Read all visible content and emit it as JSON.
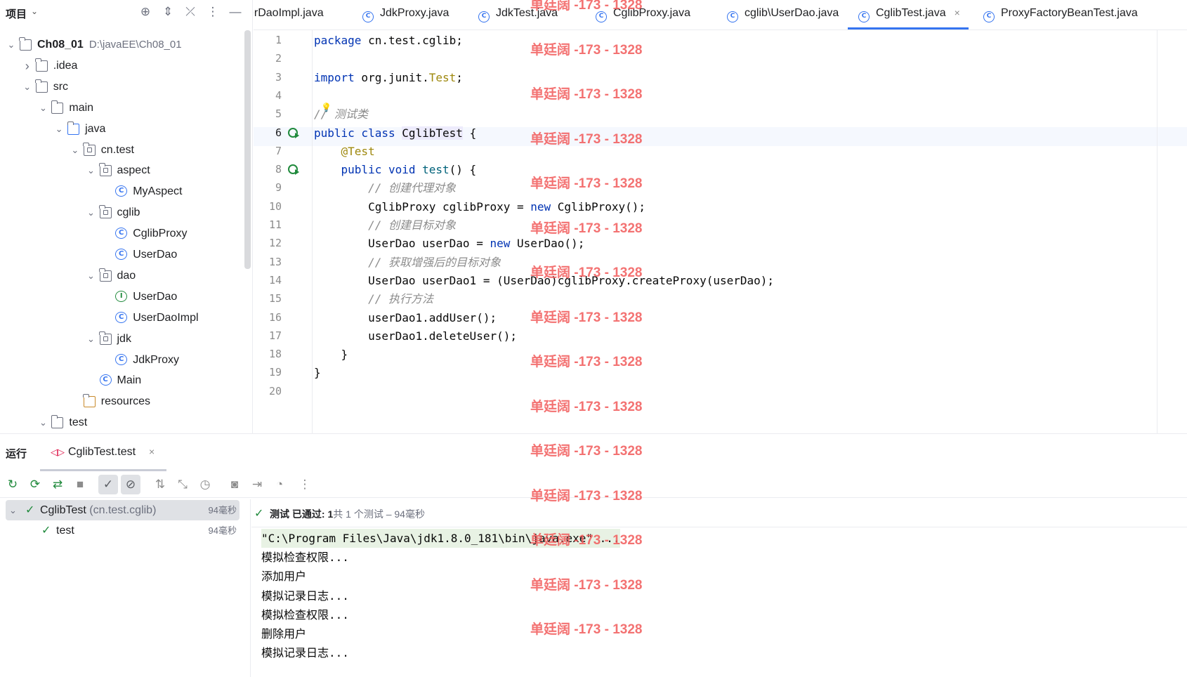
{
  "project": {
    "title": "项目",
    "tree": [
      {
        "label": "Ch08_01",
        "path": "D:\\javaEE\\Ch08_01",
        "type": "module",
        "depth": 0,
        "expanded": true
      },
      {
        "label": ".idea",
        "type": "folder",
        "depth": 1,
        "expanded": false
      },
      {
        "label": "src",
        "type": "folder",
        "depth": 1,
        "expanded": true
      },
      {
        "label": "main",
        "type": "folder",
        "depth": 2,
        "expanded": true
      },
      {
        "label": "java",
        "type": "src-folder",
        "depth": 3,
        "expanded": true
      },
      {
        "label": "cn.test",
        "type": "package",
        "depth": 4,
        "expanded": true
      },
      {
        "label": "aspect",
        "type": "package",
        "depth": 5,
        "expanded": true
      },
      {
        "label": "MyAspect",
        "type": "class",
        "depth": 6
      },
      {
        "label": "cglib",
        "type": "package",
        "depth": 5,
        "expanded": true
      },
      {
        "label": "CglibProxy",
        "type": "class",
        "depth": 6
      },
      {
        "label": "UserDao",
        "type": "class",
        "depth": 6
      },
      {
        "label": "dao",
        "type": "package",
        "depth": 5,
        "expanded": true
      },
      {
        "label": "UserDao",
        "type": "interface",
        "depth": 6
      },
      {
        "label": "UserDaoImpl",
        "type": "class",
        "depth": 6
      },
      {
        "label": "jdk",
        "type": "package",
        "depth": 5,
        "expanded": true
      },
      {
        "label": "JdkProxy",
        "type": "class",
        "depth": 6
      },
      {
        "label": "Main",
        "type": "main-class",
        "depth": 5
      },
      {
        "label": "resources",
        "type": "res-folder",
        "depth": 4
      },
      {
        "label": "test",
        "type": "folder",
        "depth": 2,
        "expanded": true
      }
    ]
  },
  "tabs": [
    {
      "label": "erDaoImpl.java"
    },
    {
      "label": "JdkProxy.java"
    },
    {
      "label": "JdkTest.java"
    },
    {
      "label": "CglibProxy.java"
    },
    {
      "label": "cglib\\UserDao.java"
    },
    {
      "label": "CglibTest.java",
      "active": true,
      "close": "×"
    },
    {
      "label": "ProxyFactoryBeanTest.java"
    }
  ],
  "editor": {
    "current_line": 6,
    "lines": [
      {
        "n": "1",
        "tokens": [
          [
            "kw",
            "package"
          ],
          [
            "",
            " cn.test.cglib;"
          ]
        ]
      },
      {
        "n": "2",
        "tokens": []
      },
      {
        "n": "3",
        "tokens": [
          [
            "kw",
            "import"
          ],
          [
            "",
            " org.junit."
          ],
          [
            "ann",
            "Test"
          ],
          [
            "",
            ";"
          ]
        ]
      },
      {
        "n": "4",
        "tokens": []
      },
      {
        "n": "5",
        "tokens": [
          [
            "cmt",
            "// 测试类"
          ]
        ]
      },
      {
        "n": "6",
        "tokens": [
          [
            "kw",
            "public class "
          ],
          [
            "hl",
            "CglibTest"
          ],
          [
            "",
            " {"
          ]
        ],
        "run": true
      },
      {
        "n": "7",
        "tokens": [
          [
            "",
            "    "
          ],
          [
            "ann",
            "@Test"
          ]
        ]
      },
      {
        "n": "8",
        "tokens": [
          [
            "",
            "    "
          ],
          [
            "kw",
            "public void "
          ],
          [
            "fn",
            "test"
          ],
          [
            "",
            "() {"
          ]
        ],
        "run": true
      },
      {
        "n": "9",
        "tokens": [
          [
            "",
            "        "
          ],
          [
            "cmt",
            "// 创建代理对象"
          ]
        ]
      },
      {
        "n": "10",
        "tokens": [
          [
            "",
            "        CglibProxy cglibProxy = "
          ],
          [
            "kw",
            "new"
          ],
          [
            "",
            " CglibProxy();"
          ]
        ]
      },
      {
        "n": "11",
        "tokens": [
          [
            "",
            "        "
          ],
          [
            "cmt",
            "// 创建目标对象"
          ]
        ]
      },
      {
        "n": "12",
        "tokens": [
          [
            "",
            "        UserDao userDao = "
          ],
          [
            "kw",
            "new"
          ],
          [
            "",
            " UserDao();"
          ]
        ]
      },
      {
        "n": "13",
        "tokens": [
          [
            "",
            "        "
          ],
          [
            "cmt",
            "// 获取增强后的目标对象"
          ]
        ]
      },
      {
        "n": "14",
        "tokens": [
          [
            "",
            "        UserDao userDao1 = (UserDao)cglibProxy.createProxy(userDao);"
          ]
        ]
      },
      {
        "n": "15",
        "tokens": [
          [
            "",
            "        "
          ],
          [
            "cmt",
            "// 执行方法"
          ]
        ]
      },
      {
        "n": "16",
        "tokens": [
          [
            "",
            "        userDao1.addUser();"
          ]
        ]
      },
      {
        "n": "17",
        "tokens": [
          [
            "",
            "        userDao1.deleteUser();"
          ]
        ]
      },
      {
        "n": "18",
        "tokens": [
          [
            "",
            "    }"
          ]
        ]
      },
      {
        "n": "19",
        "tokens": [
          [
            "",
            "}"
          ]
        ]
      },
      {
        "n": "20",
        "tokens": []
      }
    ]
  },
  "run": {
    "title": "运行",
    "tab_label": "CglibTest.test",
    "tab_close": "×",
    "toolbar": [
      {
        "name": "rerun-icon",
        "glyph": "↻"
      },
      {
        "name": "rerun-failed-icon",
        "glyph": "⟳"
      },
      {
        "name": "toggle-auto-test-icon",
        "glyph": "⇄"
      },
      {
        "name": "stop-icon",
        "glyph": "■"
      },
      {
        "name": "show-passed-icon",
        "glyph": "✓",
        "on": true
      },
      {
        "name": "show-ignored-icon",
        "glyph": "⊘",
        "on": true
      },
      {
        "name": "sort-icon",
        "glyph": "⇅"
      },
      {
        "name": "collapse-icon",
        "glyph": "⤡"
      },
      {
        "name": "history-icon",
        "glyph": "◷"
      },
      {
        "name": "screenshot-icon",
        "glyph": "◙"
      },
      {
        "name": "export-icon",
        "glyph": "⇥"
      },
      {
        "name": "gauge-icon",
        "glyph": "◔"
      },
      {
        "name": "more-icon",
        "glyph": "⋮"
      }
    ],
    "tests": [
      {
        "name": "CglibTest",
        "pkg": "(cn.test.cglib)",
        "time": "94毫秒",
        "selected": true
      },
      {
        "name": "test",
        "time": "94毫秒"
      }
    ],
    "status": {
      "label": "测试 已通过: ",
      "count": "1",
      "detail": "共 1 个测试 – 94毫秒"
    },
    "console": [
      "\"C:\\Program Files\\Java\\jdk1.8.0_181\\bin\\java.exe\" ...",
      "模拟检查权限...",
      "添加用户",
      "模拟记录日志...",
      "模拟检查权限...",
      "删除用户",
      "模拟记录日志..."
    ]
  },
  "watermark": "单廷阔 -173 - 1328"
}
